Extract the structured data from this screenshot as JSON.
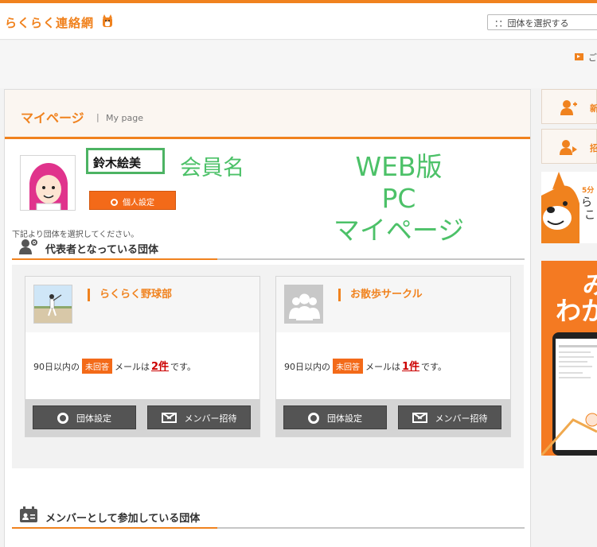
{
  "header": {
    "logo_text": "らくらく連絡網",
    "group_select_placeholder": "：：団体を選択する"
  },
  "subbar": {
    "notice_text": "ご"
  },
  "page": {
    "title": "マイページ",
    "separator": "|",
    "subtitle": "My page"
  },
  "profile": {
    "member_name": "鈴木絵美",
    "personal_settings_label": "個人設定"
  },
  "annotations": {
    "member_name_label": "会員名",
    "platform_lines": [
      "WEB版",
      "PC",
      "マイページ"
    ]
  },
  "instruction": "下記より団体を選択してください。",
  "sections": {
    "representative_title": "代表者となっている団体",
    "member_title": "メンバーとして参加している団体"
  },
  "groups": [
    {
      "name": "らくらく野球部",
      "unread_prefix": "90日以内の",
      "unread_badge": "未回答",
      "unread_mid": "メールは",
      "unread_count": "2件",
      "unread_suffix": "です。",
      "settings_label": "団体設定",
      "invite_label": "メンバー招待"
    },
    {
      "name": "お散歩サークル",
      "unread_prefix": "90日以内の",
      "unread_badge": "未回答",
      "unread_mid": "メールは",
      "unread_count": "1件",
      "unread_suffix": "です。",
      "settings_label": "団体設定",
      "invite_label": "メンバー招待"
    }
  ],
  "sidebar": {
    "buttons": [
      {
        "label": "新"
      },
      {
        "label": "招"
      }
    ],
    "promo1": {
      "line1": "5分",
      "line2": "ら",
      "line3": "こ"
    },
    "promo2": {
      "line1": "み",
      "line2": "わか"
    }
  },
  "colors": {
    "brand_orange": "#f0821e",
    "button_orange": "#f36a19",
    "annotation_green": "#4cc168",
    "alert_red": "#cc0000"
  }
}
